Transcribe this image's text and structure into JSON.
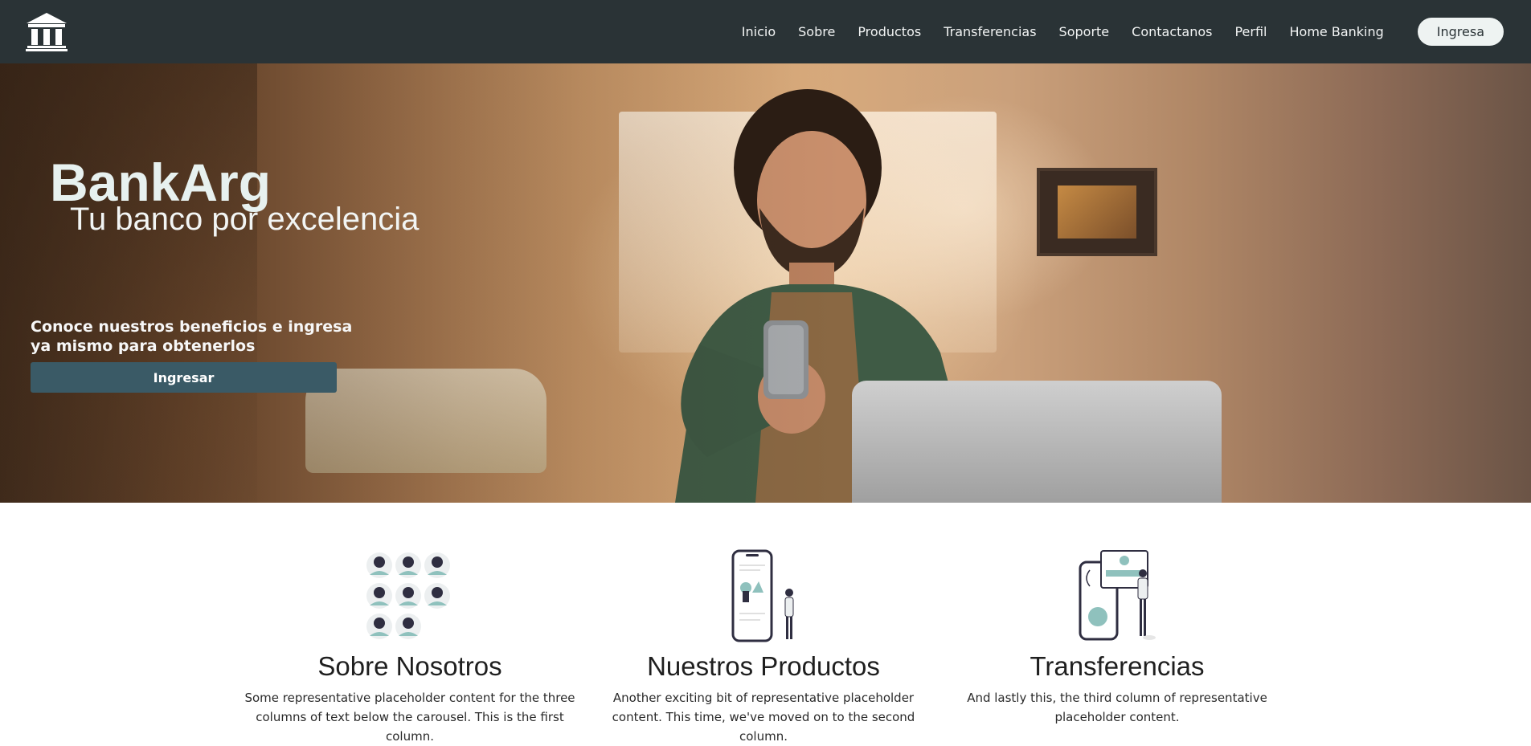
{
  "navbar": {
    "logo_icon": "bank-building-icon",
    "links": [
      "Inicio",
      "Sobre",
      "Productos",
      "Transferencias",
      "Soporte",
      "Contactanos",
      "Perfil",
      "Home Banking"
    ],
    "cta_label": "Ingresa"
  },
  "hero": {
    "title": "BankArg",
    "subtitle": "Tu banco por excelencia",
    "text": "Conoce nuestros beneficios e ingresa ya mismo para obtenerlos",
    "button_label": "Ingresar"
  },
  "features": [
    {
      "icon": "team-avatars-illustration",
      "title": "Sobre Nosotros",
      "text": "Some representative placeholder content for the three columns of text below the carousel. This is the first column."
    },
    {
      "icon": "mobile-products-illustration",
      "title": "Nuestros Productos",
      "text": "Another exciting bit of representative placeholder content. This time, we've moved on to the second column."
    },
    {
      "icon": "mobile-transfer-illustration",
      "title": "Transferencias",
      "text": "And lastly this, the third column of representative placeholder content."
    }
  ],
  "colors": {
    "navbar_bg": "#2a3336",
    "hero_button_bg": "#3a5a66",
    "nav_cta_bg": "#eef3f2",
    "illustration_accent": "#8fc1bd"
  }
}
